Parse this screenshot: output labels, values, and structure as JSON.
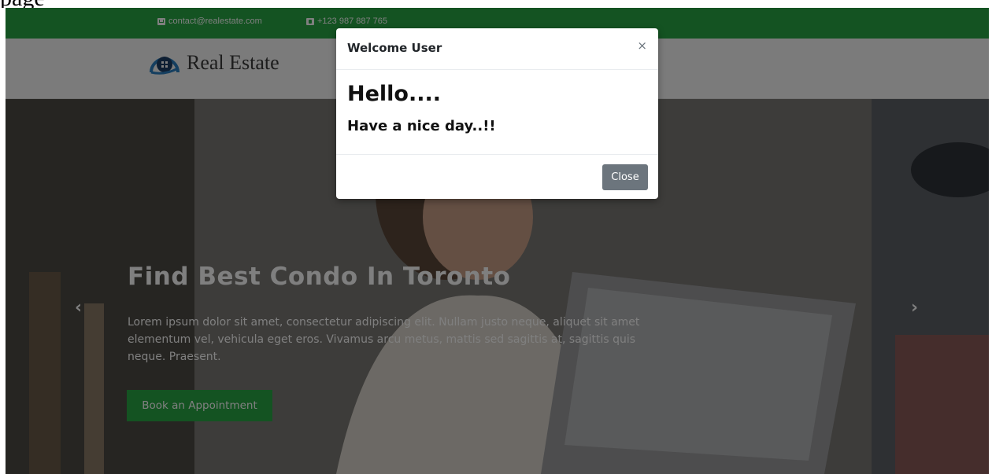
{
  "document": {
    "label": "page"
  },
  "topbar": {
    "email": "contact@realestate.com",
    "phone": "+123 987 887 765",
    "email_icon": "envelope-icon",
    "phone_icon": "phone-icon",
    "color": "#28a745"
  },
  "header": {
    "brand": "Real Estate",
    "logo_icon": "house-logo-icon"
  },
  "hero": {
    "title": "Find Best Condo In Toronto",
    "text": "Lorem ipsum dolor sit amet, consectetur adipiscing elit. Nullam justo neque, aliquet sit amet elementum vel, vehicula eget eros. Vivamus arcu metus, mattis sed sagittis at, sagittis quis neque. Praesent.",
    "button_label": "Book an Appointment",
    "prev_arrow": "‹",
    "next_arrow": "›"
  },
  "modal": {
    "title": "Welcome User",
    "close_x": "×",
    "heading": "Hello....",
    "subheading": "Have a nice day..!!",
    "close_button_label": "Close"
  },
  "colors": {
    "accent": "#28a745",
    "secondary_button": "#6c757d"
  }
}
